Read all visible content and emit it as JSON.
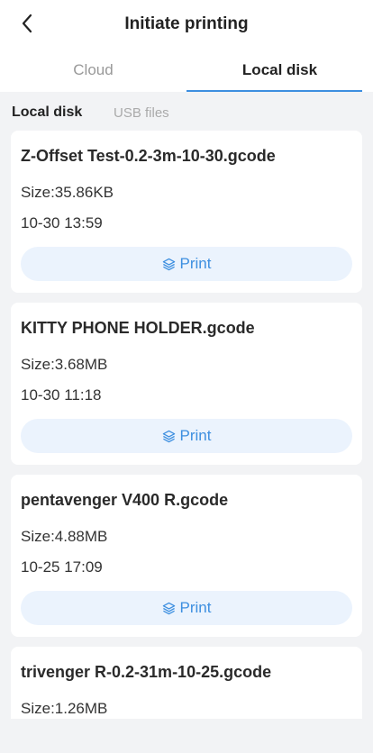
{
  "header": {
    "title": "Initiate printing",
    "back_icon": "chevron-left-icon"
  },
  "tabs": [
    {
      "label": "Cloud",
      "active": false
    },
    {
      "label": "Local disk",
      "active": true
    }
  ],
  "subtabs": [
    {
      "label": "Local disk",
      "active": true
    },
    {
      "label": "USB files",
      "active": false
    }
  ],
  "colors": {
    "accent": "#3d8fe0",
    "button_bg": "#ebf3fd",
    "page_bg": "#f2f3f5"
  },
  "files": [
    {
      "name": "Z-Offset Test-0.2-3m-10-30.gcode",
      "size": "Size:35.86KB",
      "date": "10-30 13:59",
      "print_label": "Print",
      "print_icon": "layers-icon"
    },
    {
      "name": "KITTY PHONE HOLDER.gcode",
      "size": "Size:3.68MB",
      "date": "10-30 11:18",
      "print_label": "Print",
      "print_icon": "layers-icon"
    },
    {
      "name": "pentavenger V400 R.gcode",
      "size": "Size:4.88MB",
      "date": "10-25 17:09",
      "print_label": "Print",
      "print_icon": "layers-icon"
    },
    {
      "name": "trivenger R-0.2-31m-10-25.gcode",
      "size": "Size:1.26MB"
    }
  ]
}
